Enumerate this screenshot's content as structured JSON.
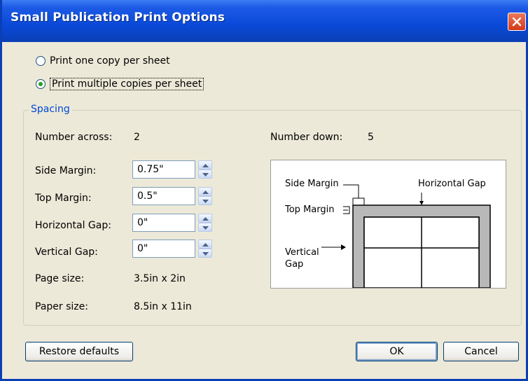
{
  "window": {
    "title": "Small Publication Print Options"
  },
  "print_mode": {
    "options": [
      {
        "label": "Print one copy per sheet",
        "mnemonic": "o",
        "selected": false
      },
      {
        "label": "Print multiple copies per sheet",
        "mnemonic": "m",
        "selected": true
      }
    ]
  },
  "spacing": {
    "legend": "Spacing",
    "number_across_label": "Number across:",
    "number_across_value": "2",
    "number_down_label": "Number down:",
    "number_down_value": "5",
    "side_margin_label": "Side Margin:",
    "side_margin_value": "0.75\"",
    "top_margin_label": "Top Margin:",
    "top_margin_value": "0.5\"",
    "horizontal_gap_label": "Horizontal Gap:",
    "horizontal_gap_value": "0\"",
    "vertical_gap_label": "Vertical Gap:",
    "vertical_gap_value": "0\"",
    "page_size_label": "Page size:",
    "page_size_value": "3.5in x 2in",
    "paper_size_label": "Paper size:",
    "paper_size_value": "8.5in x 11in"
  },
  "diagram": {
    "side_margin": "Side Margin",
    "top_margin": "Top Margin",
    "horizontal_gap": "Horizontal Gap",
    "vertical_gap_line1": "Vertical",
    "vertical_gap_line2": "Gap"
  },
  "buttons": {
    "restore_defaults": "Restore defaults",
    "ok": "OK",
    "cancel": "Cancel"
  },
  "colors": {
    "title_bar": "#0a49d8",
    "close_button": "#d3391a",
    "group_legend": "#0046d5",
    "radio_dot": "#21a121"
  }
}
